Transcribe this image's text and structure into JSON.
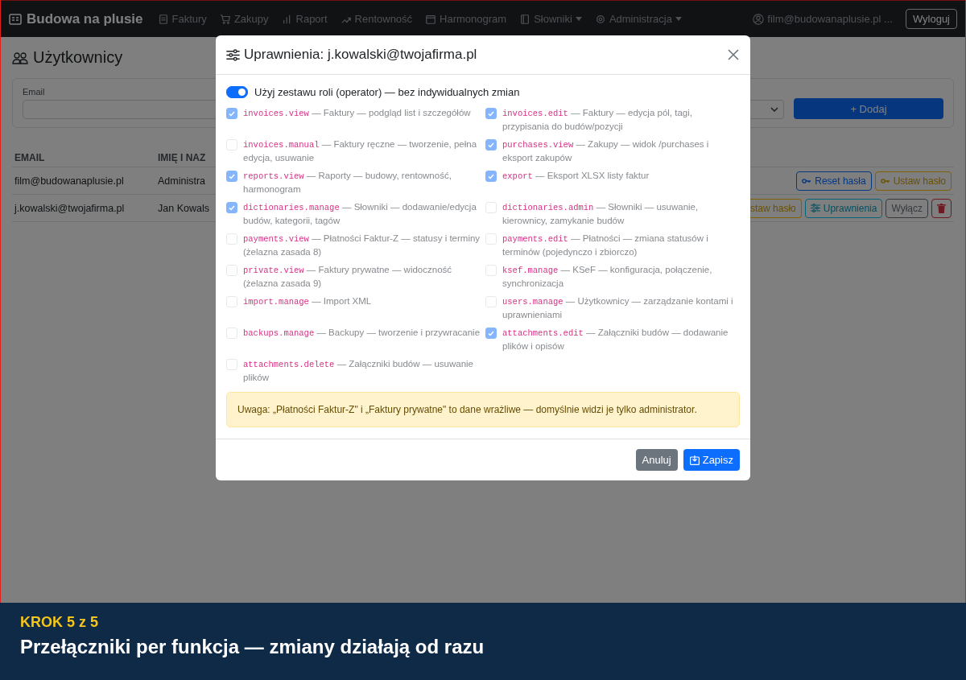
{
  "navbar": {
    "brand": "Budowa na plusie",
    "items": [
      {
        "label": "Faktury",
        "caret": false
      },
      {
        "label": "Zakupy",
        "caret": false
      },
      {
        "label": "Raport",
        "caret": false
      },
      {
        "label": "Rentowność",
        "caret": false
      },
      {
        "label": "Harmonogram",
        "caret": false
      },
      {
        "label": "Słowniki",
        "caret": true
      },
      {
        "label": "Administracja",
        "caret": true
      }
    ],
    "user": "film@budowanaplusie.pl ...",
    "logout": "Wyloguj"
  },
  "page": {
    "title": "Użytkownicy",
    "filter": {
      "email_label": "Email",
      "add_button": "+ Dodaj"
    },
    "table": {
      "columns": [
        "EMAIL",
        "IMIĘ I NAZ"
      ],
      "rows": [
        {
          "email": "film@budowanaplusie.pl",
          "name": "Administra",
          "actions": [
            {
              "label": "Reset hasła",
              "kind": "reset"
            },
            {
              "label": "Ustaw hasło",
              "kind": "set"
            }
          ]
        },
        {
          "email": "j.kowalski@twojafirma.pl",
          "name": "Jan Kowals",
          "actions": [
            {
              "label": "staw hasło",
              "kind": "set-cut"
            },
            {
              "label": "Uprawnienia",
              "kind": "perm"
            },
            {
              "label": "Wyłącz",
              "kind": "disable"
            },
            {
              "kind": "delete"
            }
          ]
        }
      ]
    }
  },
  "modal": {
    "title": "Uprawnienia: j.kowalski@twojafirma.pl",
    "role_toggle": {
      "label": "Użyj zestawu roli (operator) — bez indywidualnych zmian",
      "on": true
    },
    "permissions": [
      {
        "code": "invoices.view",
        "description": "— Faktury — podgląd list i szczegółów",
        "checked": true
      },
      {
        "code": "invoices.edit",
        "description": "— Faktury — edycja pól, tagi, przypisania do budów/pozycji",
        "checked": true
      },
      {
        "code": "invoices.manual",
        "description": "— Faktury ręczne — tworzenie, pełna edycja, usuwanie",
        "checked": false
      },
      {
        "code": "purchases.view",
        "description": "— Zakupy — widok /purchases i eksport zakupów",
        "checked": true
      },
      {
        "code": "reports.view",
        "description": "— Raporty — budowy, rentowność, harmonogram",
        "checked": true
      },
      {
        "code": "export",
        "description": "— Eksport XLSX listy faktur",
        "checked": true
      },
      {
        "code": "dictionaries.manage",
        "description": "— Słowniki — dodawanie/edycja budów, kategorii, tagów",
        "checked": true
      },
      {
        "code": "dictionaries.admin",
        "description": "— Słowniki — usuwanie, kierownicy, zamykanie budów",
        "checked": false
      },
      {
        "code": "payments.view",
        "description": "— Płatności Faktur-Z — statusy i terminy (żelazna zasada 8)",
        "checked": false
      },
      {
        "code": "payments.edit",
        "description": "— Płatności — zmiana statusów i terminów (pojedynczo i zbiorczo)",
        "checked": false
      },
      {
        "code": "private.view",
        "description": "— Faktury prywatne — widoczność (żelazna zasada 9)",
        "checked": false
      },
      {
        "code": "ksef.manage",
        "description": "— KSeF — konfiguracja, połączenie, synchronizacja",
        "checked": false
      },
      {
        "code": "import.manage",
        "description": "— Import XML",
        "checked": false
      },
      {
        "code": "users.manage",
        "description": "— Użytkownicy — zarządzanie kontami i uprawnieniami",
        "checked": false
      },
      {
        "code": "backups.manage",
        "description": "— Backupy — tworzenie i przywracanie",
        "checked": false
      },
      {
        "code": "attachments.edit",
        "description": "— Załączniki budów — dodawanie plików i opisów",
        "checked": true
      },
      {
        "code": "attachments.delete",
        "description": "— Załączniki budów — usuwanie plików",
        "checked": false
      }
    ],
    "alert": "Uwaga: „Płatności Faktur-Z\" i „Faktury prywatne\" to dane wrażliwe — domyślnie widzi je tylko administrator.",
    "cancel": "Anuluj",
    "save": "Zapisz"
  },
  "banner": {
    "step": "KROK 5 z 5",
    "caption": "Przełączniki per funkcja — zmiany działają od razu"
  }
}
